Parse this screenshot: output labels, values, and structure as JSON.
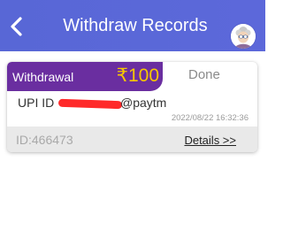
{
  "header": {
    "title": "Withdraw Records",
    "back_icon": "chevron-left-icon",
    "avatar_icon": "user-avatar-icon",
    "background": "#5a67d8"
  },
  "records": [
    {
      "type": "Withdrawal",
      "amount": "₹100",
      "status": "Done",
      "method_prefix": "UPI ID",
      "account_suffix": "@paytm",
      "timestamp": "2022/08/22 16:32:36",
      "id_label": "ID:466473",
      "details_label": "Details >>"
    }
  ],
  "colors": {
    "card_head": "#6a2ea0",
    "amount": "#f6c700",
    "redaction": "#ff2a2a"
  }
}
